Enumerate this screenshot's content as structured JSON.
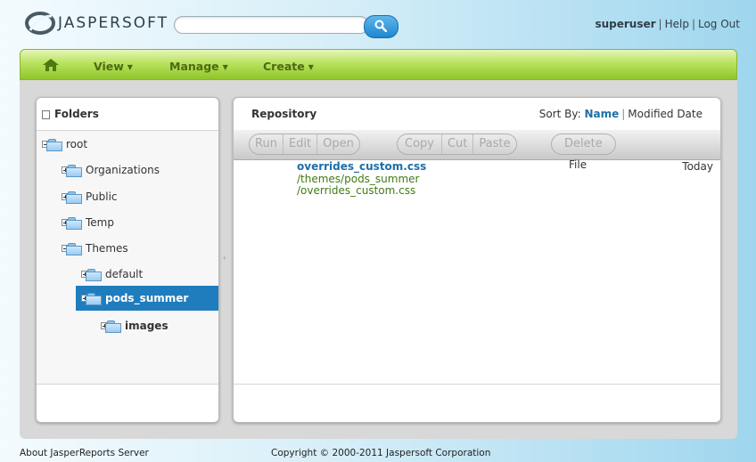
{
  "header": {
    "logo_text": "JASPERSOFT",
    "search": {
      "value": "",
      "placeholder": ""
    },
    "user": "superuser",
    "help": "Help",
    "logout": "Log Out",
    "separator": "|"
  },
  "menu": {
    "items": [
      {
        "label": "View"
      },
      {
        "label": "Manage"
      },
      {
        "label": "Create"
      }
    ],
    "caret": "▼"
  },
  "folders": {
    "title": "Folders",
    "tree": [
      {
        "label": "root",
        "expanded": true,
        "selected": false
      },
      {
        "label": "Organizations",
        "expanded": false,
        "selected": false
      },
      {
        "label": "Public",
        "expanded": false,
        "selected": false
      },
      {
        "label": "Temp",
        "expanded": false,
        "selected": false
      },
      {
        "label": "Themes",
        "expanded": true,
        "selected": false
      },
      {
        "label": "default",
        "expanded": false,
        "selected": false
      },
      {
        "label": "pods_summer",
        "expanded": false,
        "selected": true
      },
      {
        "label": "images",
        "expanded": false,
        "selected": false
      }
    ]
  },
  "repository": {
    "title": "Repository",
    "sort_by_label": "Sort By:",
    "sort_options": [
      "Name",
      "Modified Date"
    ],
    "toolbar": {
      "group1": [
        "Run",
        "Edit",
        "Open"
      ],
      "group2": [
        "Copy",
        "Cut",
        "Paste"
      ],
      "group3": [
        "Delete"
      ]
    },
    "results": [
      {
        "name": "overrides_custom.css",
        "path_line1": "/themes/pods_summer",
        "path_line2": "/overrides_custom.css",
        "type": "File",
        "modified": "Today"
      }
    ]
  },
  "footer": {
    "about": "About JasperReports Server",
    "copyright": "Copyright © 2000-2011 Jaspersoft Corporation"
  },
  "colors": {
    "accent": "#1f7dbd",
    "menu_green": "#8fc52a",
    "link_blue": "#1d6ea8",
    "path_green": "#3f7b12"
  }
}
